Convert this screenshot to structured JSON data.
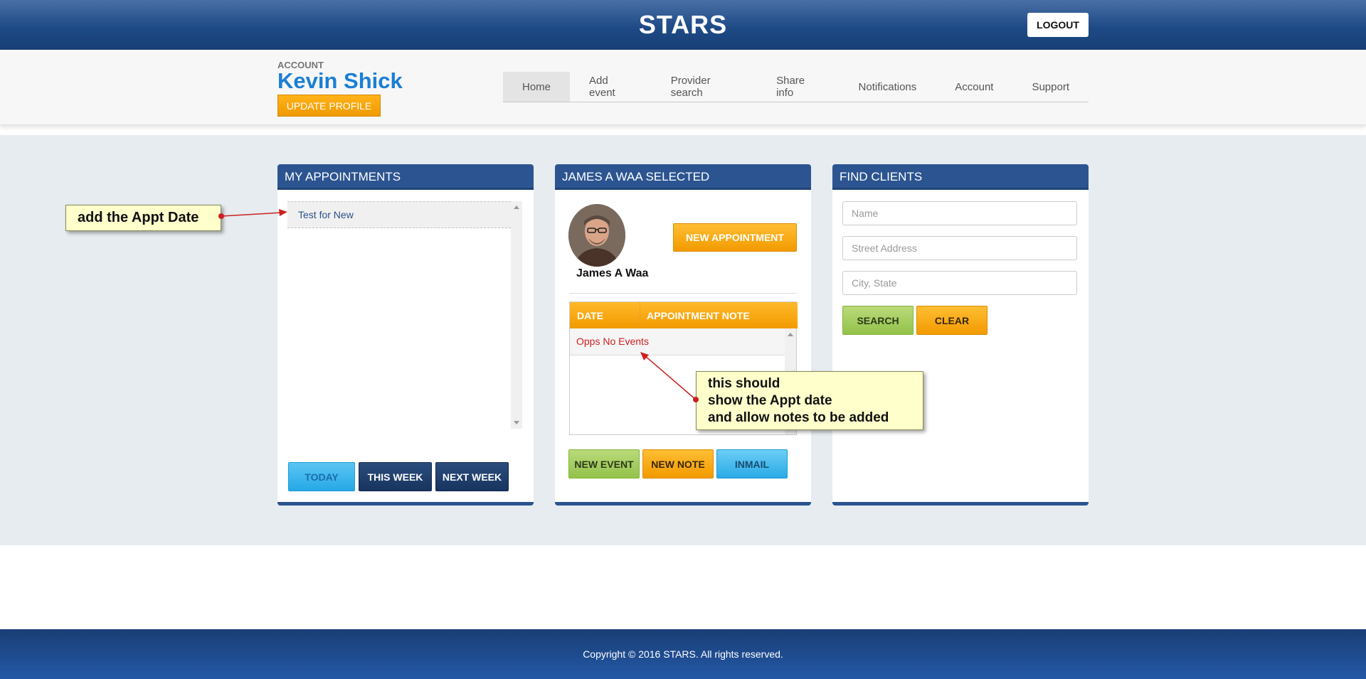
{
  "header": {
    "title": "STARS",
    "logout_label": "LOGOUT"
  },
  "account": {
    "label": "ACCOUNT",
    "name": "Kevin Shick",
    "update_label": "UPDATE PROFILE"
  },
  "nav": {
    "items": [
      "Home",
      "Add event",
      "Provider search",
      "Share info",
      "Notifications",
      "Account",
      "Support"
    ],
    "active": "Home"
  },
  "appointments": {
    "title": "MY APPOINTMENTS",
    "items": [
      "Test for New"
    ],
    "buttons": {
      "today": "TODAY",
      "this_week": "THIS WEEK",
      "next_week": "NEXT WEEK"
    }
  },
  "selected": {
    "title": "JAMES A WAA SELECTED",
    "person_name": "James A Waa",
    "new_appointment_label": "NEW APPOINTMENT",
    "table": {
      "col_date": "DATE",
      "col_note": "APPOINTMENT NOTE",
      "empty_message": "Opps No Events"
    },
    "buttons": {
      "new_event": "NEW EVENT",
      "new_note": "NEW NOTE",
      "inmail": "INMAIL"
    }
  },
  "find_clients": {
    "title": "FIND CLIENTS",
    "name_placeholder": "Name",
    "street_placeholder": "Street Address",
    "city_placeholder": "City, State",
    "search_label": "SEARCH",
    "clear_label": "CLEAR"
  },
  "annotations": {
    "callout1": "add the Appt Date",
    "callout2_line1": "this should",
    "callout2_line2": "show the Appt date",
    "callout2_line3": "and allow notes to be added"
  },
  "footer": {
    "copyright": "Copyright © 2016 STARS. All rights reserved."
  },
  "colors": {
    "header_blue": "#1e4a86",
    "accent_orange": "#f29a00",
    "name_blue": "#1a7fd4",
    "band": "#e6ecf0"
  }
}
